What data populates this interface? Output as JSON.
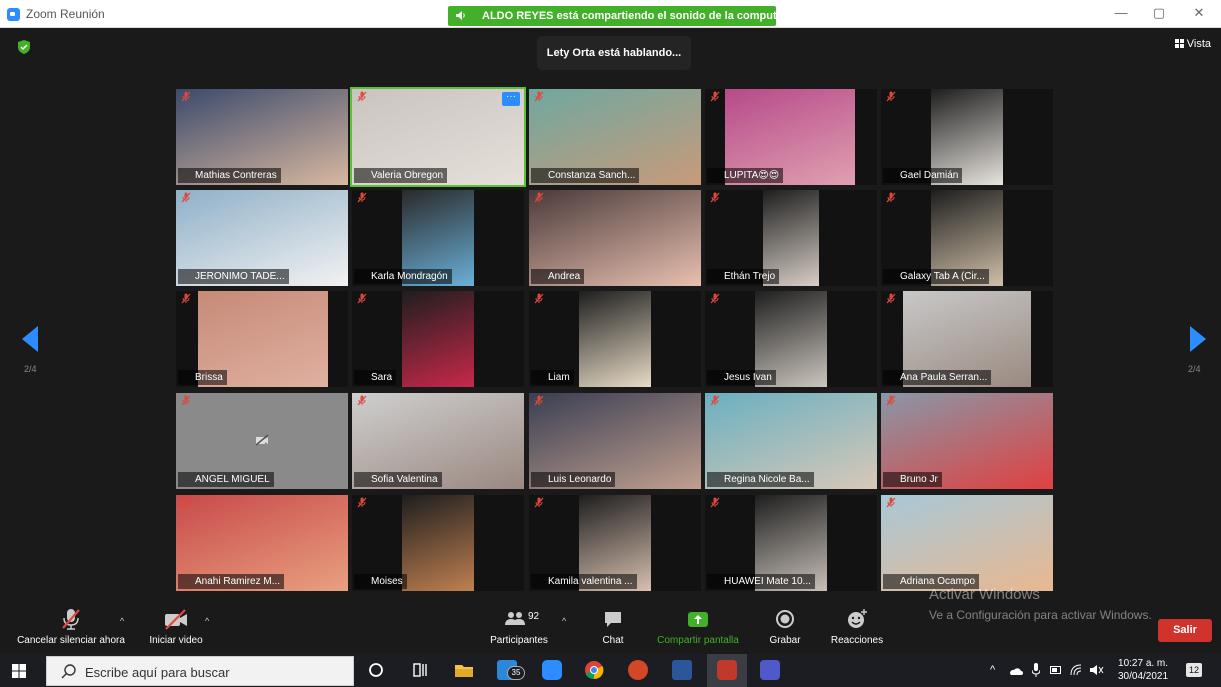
{
  "window": {
    "title": "Zoom Reunión",
    "minimize": "—",
    "maximize": "▢",
    "close": "✕"
  },
  "share_banner": "ALDO REYES está compartiendo el sonido de la computadora",
  "speaking_indicator": "Lety Orta está hablando...",
  "view_button": "Vista",
  "page_indicator": {
    "left": "2/4",
    "right": "2/4"
  },
  "participants": [
    {
      "name": "Mathias Contreras"
    },
    {
      "name": "Valeria Obregon"
    },
    {
      "name": "Constanza Sanch..."
    },
    {
      "name": "LUPITA😍😍"
    },
    {
      "name": "Gael Damián"
    },
    {
      "name": "JERONIMO TADE..."
    },
    {
      "name": "Karla Mondragón"
    },
    {
      "name": "Andrea"
    },
    {
      "name": "Ethán Trejo"
    },
    {
      "name": "Galaxy Tab A (Cir..."
    },
    {
      "name": "Brissa"
    },
    {
      "name": "Sara"
    },
    {
      "name": "Liam"
    },
    {
      "name": "Jesus Ivan"
    },
    {
      "name": "Ana Paula Serran..."
    },
    {
      "name": "ANGEL MIGUEL"
    },
    {
      "name": "Sofia Valentina"
    },
    {
      "name": "Luis Leonardo"
    },
    {
      "name": "Regina Nicole Ba..."
    },
    {
      "name": "Bruno Jr"
    },
    {
      "name": "Anahi Ramirez M..."
    },
    {
      "name": "Moises"
    },
    {
      "name": "Kamila valentina ..."
    },
    {
      "name": "HUAWEI Mate 10..."
    },
    {
      "name": "Adriana Ocampo"
    }
  ],
  "toolbar": {
    "unmute_label": "Cancelar silenciar ahora",
    "video_label": "Iniciar video",
    "participants_label": "Participantes",
    "participants_count": "92",
    "chat_label": "Chat",
    "share_label": "Compartir pantalla",
    "record_label": "Grabar",
    "reactions_label": "Reacciones",
    "leave_label": "Salir"
  },
  "watermark": {
    "title": "Activar Windows",
    "subtitle": "Ve a Configuración para activar Windows."
  },
  "taskbar": {
    "search_placeholder": "Escribe aquí para buscar",
    "mail_badge": "35",
    "time": "10:27 a. m.",
    "date": "30/04/2021",
    "notifications": "12"
  },
  "colors": {
    "zoom_blue": "#2d8cff",
    "share_green": "#43b02a",
    "leave_red": "#d0332c",
    "muted_red": "#e0473d"
  }
}
